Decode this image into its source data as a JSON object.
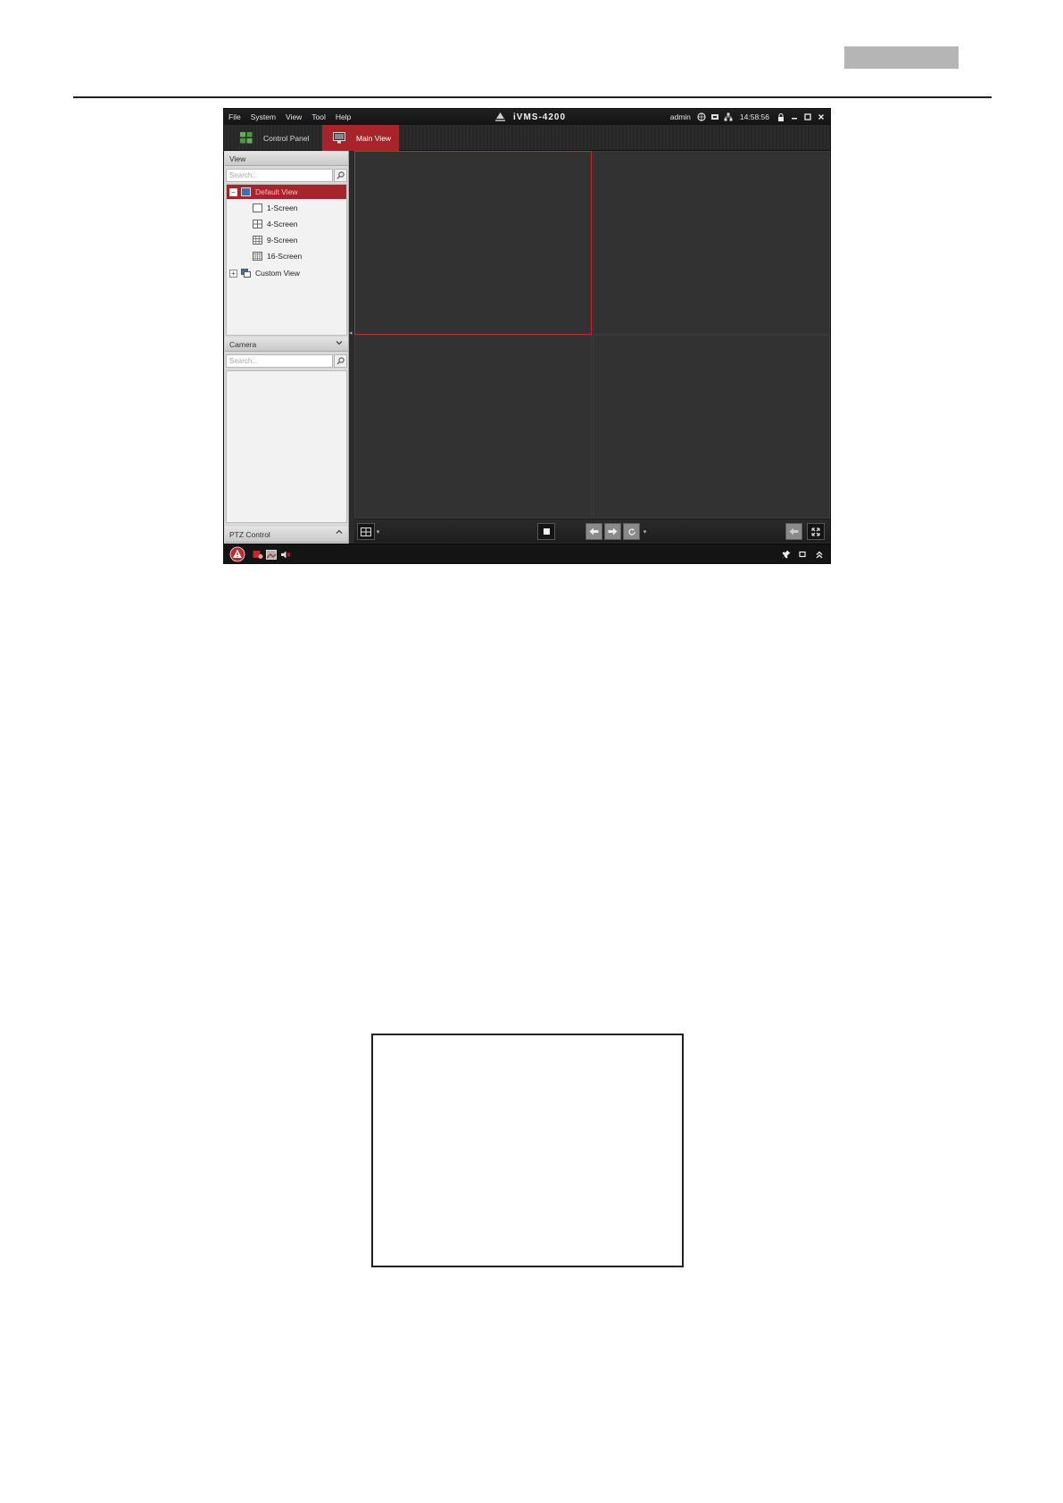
{
  "app": {
    "title": "iVMS-4200",
    "menu": [
      "File",
      "System",
      "View",
      "Tool",
      "Help"
    ],
    "user": "admin",
    "time": "14:58:56"
  },
  "tabs": [
    {
      "label": "Control Panel",
      "icon": "grid-icon"
    },
    {
      "label": "Main View",
      "icon": "monitor-icon"
    }
  ],
  "sidebar": {
    "view_panel": {
      "title": "View",
      "search_placeholder": "Search...",
      "tree": [
        {
          "label": "Default View",
          "selected": true,
          "expanded": true
        },
        {
          "label": "1-Screen"
        },
        {
          "label": "4-Screen"
        },
        {
          "label": "9-Screen"
        },
        {
          "label": "16-Screen"
        },
        {
          "label": "Custom View",
          "expanded": false
        }
      ]
    },
    "camera_panel": {
      "title": "Camera",
      "search_placeholder": "Search..."
    },
    "ptz_panel": {
      "title": "PTZ Control"
    }
  },
  "video_grid": {
    "layout": "2x2",
    "active_cell": 1
  },
  "colors": {
    "accent": "#a8232a",
    "active_border": "#c8262e",
    "background": "#303030"
  }
}
